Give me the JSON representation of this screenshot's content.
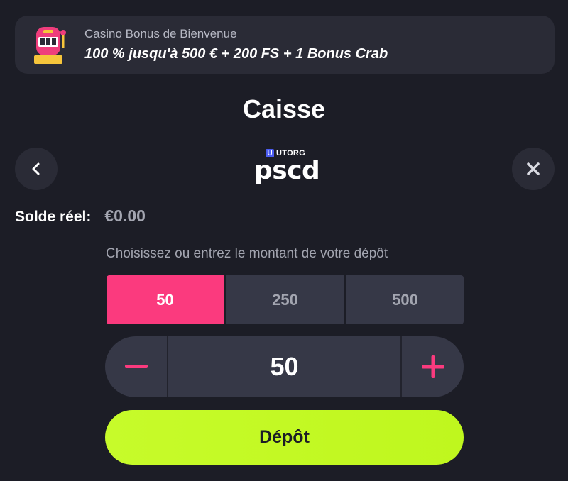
{
  "banner": {
    "icon": "slot-machine-icon",
    "subtitle": "Casino Bonus de Bienvenue",
    "offer": "100 % jusqu'à 500 € + 200 FS + 1 Bonus Crab"
  },
  "header": {
    "title": "Caisse",
    "back_icon": "chevron-left-icon",
    "close_icon": "close-icon"
  },
  "provider": {
    "badge_letter": "U",
    "brand": "UTORG",
    "name": "pscd"
  },
  "balance": {
    "label": "Solde réel:",
    "value": "€0.00"
  },
  "deposit_form": {
    "hint": "Choisissez ou entrez le montant de votre dépôt",
    "preset_amounts": [
      "50",
      "250",
      "500"
    ],
    "selected_amount": "50",
    "current_value": "50",
    "decrement_icon": "minus-icon",
    "increment_icon": "plus-icon",
    "submit_label": "Dépôt"
  },
  "colors": {
    "background": "#1c1d26",
    "panel": "#2a2b36",
    "accent_pink": "#fb3a7e",
    "accent_lime": "#c7fb2a",
    "muted_text": "#a3a5b0"
  }
}
